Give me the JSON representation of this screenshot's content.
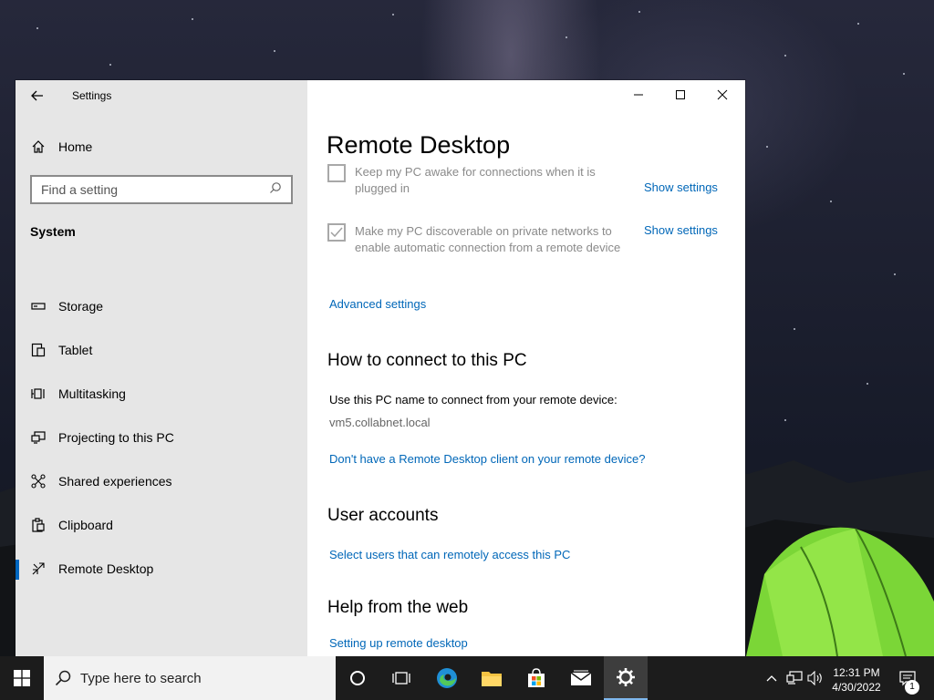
{
  "window": {
    "title": "Settings",
    "controls": {
      "minimize": "minimize",
      "maximize": "maximize",
      "close": "close"
    }
  },
  "sidebar": {
    "home_label": "Home",
    "search_placeholder": "Find a setting",
    "section": "System",
    "items": [
      {
        "label": "Storage",
        "icon": "storage-icon"
      },
      {
        "label": "Tablet",
        "icon": "tablet-icon"
      },
      {
        "label": "Multitasking",
        "icon": "multitasking-icon"
      },
      {
        "label": "Projecting to this PC",
        "icon": "projecting-icon"
      },
      {
        "label": "Shared experiences",
        "icon": "shared-experiences-icon"
      },
      {
        "label": "Clipboard",
        "icon": "clipboard-icon"
      },
      {
        "label": "Remote Desktop",
        "icon": "remote-desktop-icon",
        "active": true
      }
    ]
  },
  "main": {
    "title": "Remote Desktop",
    "settings": [
      {
        "text": "Keep my PC awake for connections when it is plugged in",
        "checked": false,
        "link": "Show settings"
      },
      {
        "text": "Make my PC discoverable on private networks to enable automatic connection from a remote device",
        "checked": true,
        "link": "Show settings"
      }
    ],
    "advanced_link": "Advanced settings",
    "connect": {
      "heading": "How to connect to this PC",
      "instruction": "Use this PC name to connect from your remote device:",
      "pc_name": "vm5.collabnet.local",
      "client_link": "Don't have a Remote Desktop client on your remote device?"
    },
    "accounts": {
      "heading": "User accounts",
      "link": "Select users that can remotely access this PC"
    },
    "help": {
      "heading": "Help from the web",
      "link": "Setting up remote desktop"
    }
  },
  "taskbar": {
    "search_placeholder": "Type here to search",
    "time": "12:31 PM",
    "date": "4/30/2022",
    "notification_count": "1"
  },
  "colors": {
    "accent": "#0067b8",
    "sidebar_bg": "#e6e6e6",
    "taskbar_bg": "#1c1c1c"
  }
}
